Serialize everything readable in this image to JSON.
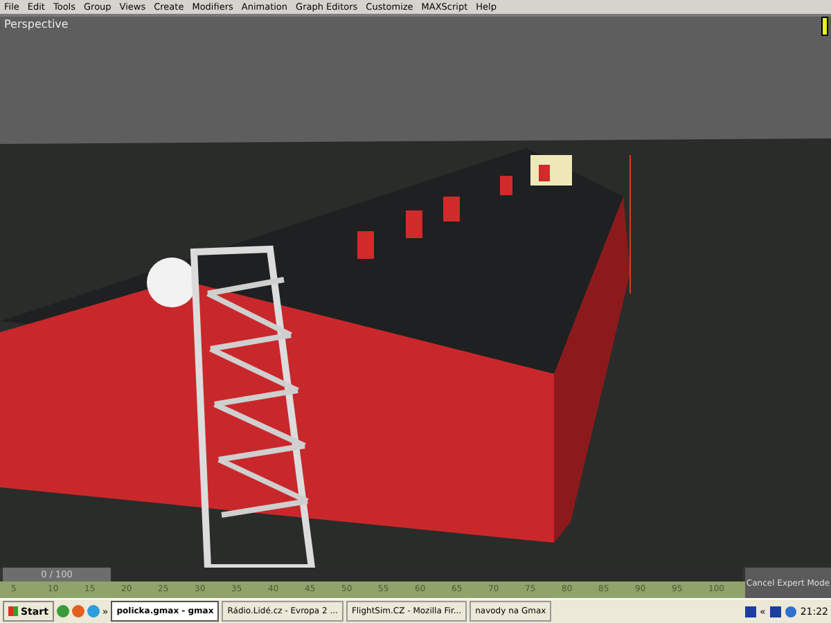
{
  "menu": [
    "File",
    "Edit",
    "Tools",
    "Group",
    "Views",
    "Create",
    "Modifiers",
    "Animation",
    "Graph Editors",
    "Customize",
    "MAXScript",
    "Help"
  ],
  "viewport": {
    "label": "Perspective"
  },
  "timeline": {
    "slider": "0 / 100",
    "ticks": [
      "5",
      "10",
      "15",
      "20",
      "25",
      "30",
      "35",
      "40",
      "45",
      "50",
      "55",
      "60",
      "65",
      "70",
      "75",
      "80",
      "85",
      "90",
      "95",
      "100"
    ]
  },
  "expert_button": "Cancel Expert Mode",
  "taskbar": {
    "start": "Start",
    "more": "»",
    "tasks": [
      {
        "label": "policka.gmax - gmax",
        "selected": true
      },
      {
        "label": "Rádio.Lidé.cz - Evropa 2 ...",
        "selected": false
      },
      {
        "label": "FlightSim.CZ - Mozilla Fir...",
        "selected": false
      },
      {
        "label": "navody na Gmax",
        "selected": false
      }
    ],
    "tray_more": "«",
    "clock": "21:22"
  }
}
